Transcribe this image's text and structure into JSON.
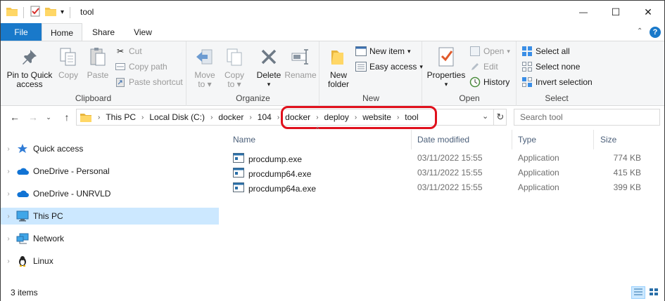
{
  "window": {
    "title": "tool",
    "controls": {
      "minimize": "—",
      "maximize": "☐",
      "close": "✕"
    }
  },
  "ribbon_tabs": [
    "File",
    "Home",
    "Share",
    "View"
  ],
  "ribbon": {
    "clipboard": {
      "label": "Clipboard",
      "pin_label_1": "Pin to Quick",
      "pin_label_2": "access",
      "copy": "Copy",
      "paste": "Paste",
      "cut": "Cut",
      "copy_path": "Copy path",
      "paste_shortcut": "Paste shortcut"
    },
    "organize": {
      "label": "Organize",
      "move_to_1": "Move",
      "move_to_2": "to",
      "copy_to_1": "Copy",
      "copy_to_2": "to",
      "delete": "Delete",
      "rename": "Rename"
    },
    "new": {
      "label": "New",
      "new_folder_1": "New",
      "new_folder_2": "folder",
      "new_item": "New item",
      "easy_access": "Easy access"
    },
    "open": {
      "label": "Open",
      "properties": "Properties",
      "open": "Open",
      "edit": "Edit",
      "history": "History"
    },
    "select": {
      "label": "Select",
      "select_all": "Select all",
      "select_none": "Select none",
      "invert_selection": "Invert selection"
    }
  },
  "address": {
    "crumbs_before": [
      "This PC",
      "Local Disk (C:)",
      "docker",
      "104"
    ],
    "crumbs_highlighted": [
      "docker",
      "deploy",
      "website",
      "tool"
    ],
    "search_placeholder": "Search tool"
  },
  "nav_pane": {
    "items": [
      {
        "label": "Quick access",
        "icon": "star-icon",
        "selected": false
      },
      {
        "label": "OneDrive - Personal",
        "icon": "cloud-icon",
        "selected": false
      },
      {
        "label": "OneDrive - UNRVLD",
        "icon": "cloud-icon",
        "selected": false
      },
      {
        "label": "This PC",
        "icon": "computer-icon",
        "selected": true
      },
      {
        "label": "Network",
        "icon": "network-icon",
        "selected": false
      },
      {
        "label": "Linux",
        "icon": "penguin-icon",
        "selected": false
      }
    ]
  },
  "file_list": {
    "columns": [
      "Name",
      "Date modified",
      "Type",
      "Size"
    ],
    "rows": [
      {
        "name": "procdump.exe",
        "date": "03/11/2022 15:55",
        "type": "Application",
        "size": "774 KB"
      },
      {
        "name": "procdump64.exe",
        "date": "03/11/2022 15:55",
        "type": "Application",
        "size": "415 KB"
      },
      {
        "name": "procdump64a.exe",
        "date": "03/11/2022 15:55",
        "type": "Application",
        "size": "399 KB"
      }
    ]
  },
  "status": {
    "item_count": "3 items"
  },
  "colors": {
    "accent": "#1979ca",
    "selected": "#cce8ff",
    "highlight": "#e0101c",
    "ribbon_bg": "#f5f6f7"
  }
}
